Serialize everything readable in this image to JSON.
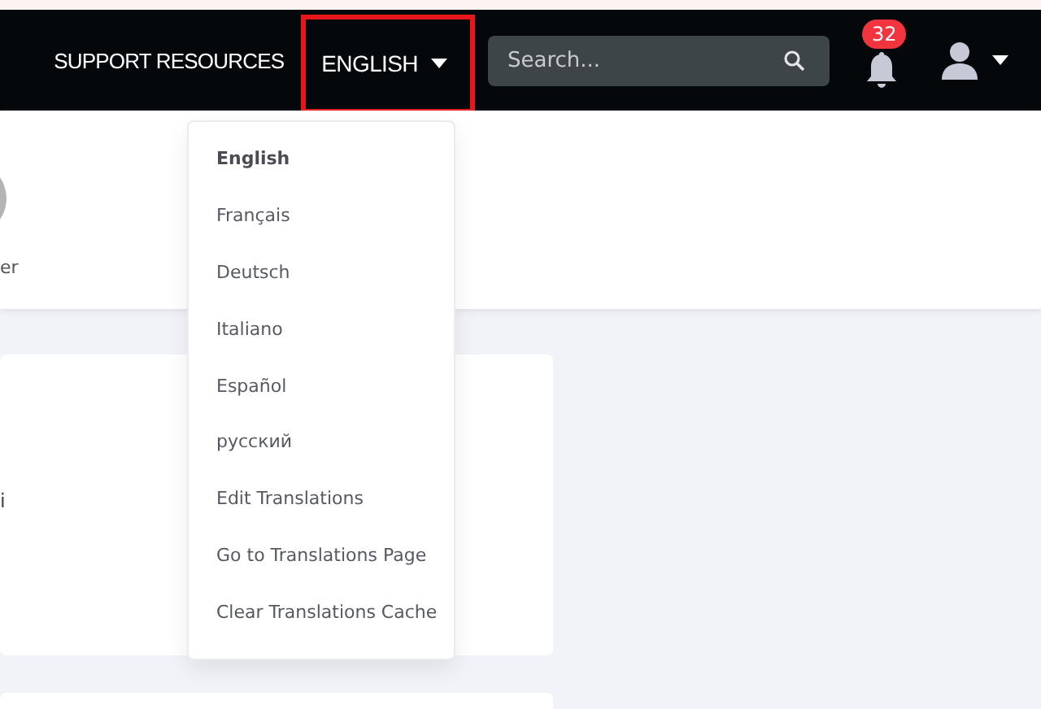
{
  "navbar": {
    "link": "SUPPORT RESOURCES",
    "language_menu": {
      "label": "ENGLISH",
      "highlighted": true,
      "items": [
        {
          "label": "English",
          "selected": true
        },
        {
          "label": "Français",
          "selected": false
        },
        {
          "label": "Deutsch",
          "selected": false
        },
        {
          "label": "Italiano",
          "selected": false
        },
        {
          "label": "Español",
          "selected": false
        },
        {
          "label": "русский",
          "selected": false
        },
        {
          "label": "Edit Translations",
          "selected": false
        },
        {
          "label": "Go to Translations Page",
          "selected": false
        },
        {
          "label": "Clear Translations Cache",
          "selected": false
        }
      ]
    },
    "search": {
      "placeholder": "Search..."
    },
    "notifications": {
      "badge": "32"
    }
  },
  "profile_header": {
    "caption": "er"
  },
  "card": {
    "text": "i"
  }
}
